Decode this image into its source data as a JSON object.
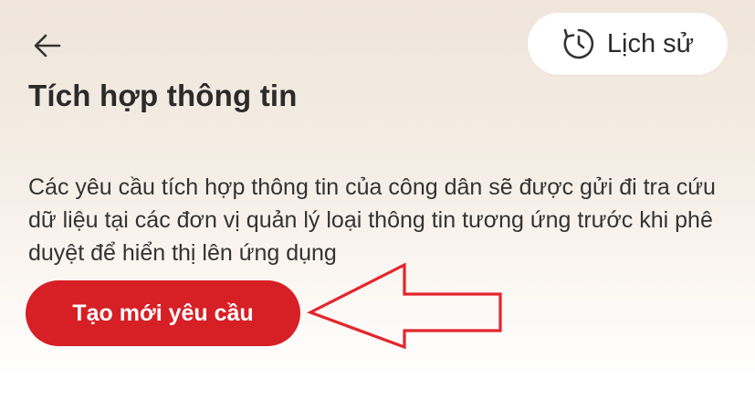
{
  "header": {
    "back_icon": "arrow-left-icon",
    "history_icon": "history-clock-icon",
    "history_label": "Lịch sử"
  },
  "page": {
    "title": "Tích hợp thông tin",
    "description": "Các yêu cầu tích hợp thông tin của công dân sẽ được gửi đi tra cứu dữ liệu tại các đơn vị quản lý loại thông tin tương ứng trước khi phê duyệt để hiển thị lên ứng dụng"
  },
  "actions": {
    "create_label": "Tạo mới yêu cầu"
  },
  "annotation": {
    "icon": "red-outline-arrow-left"
  },
  "colors": {
    "accent": "#d71f26",
    "text": "#2b2b2b",
    "background_top": "#efe5da",
    "background_bottom": "#ffffff"
  }
}
